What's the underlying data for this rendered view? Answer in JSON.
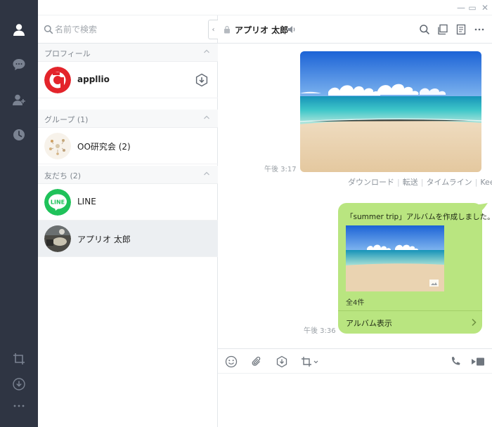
{
  "window": {
    "minimize_glyph": "—",
    "maximize_glyph": "▭",
    "close_glyph": "✕"
  },
  "rail": {
    "items": [
      "friends-icon",
      "chats-icon",
      "add-friend-icon",
      "timeline-icon"
    ],
    "bottom": [
      "screenshot-icon",
      "download-icon",
      "more-icon"
    ]
  },
  "sidebar": {
    "search_placeholder": "名前で検索",
    "collapse_glyph": "‹",
    "sections": {
      "profile": {
        "label": "プロフィール"
      },
      "groups": {
        "label": "グループ (1)"
      },
      "friends": {
        "label": "友だち (2)"
      }
    },
    "profile": {
      "name": "appllio"
    },
    "groups": [
      {
        "name": "OO研究会 (2)"
      }
    ],
    "friends": [
      {
        "name": "LINE"
      },
      {
        "name": "アプリオ 太郎"
      }
    ]
  },
  "chat": {
    "title": "アプリオ 太郎",
    "messages": {
      "photo_time": "午後 3:17",
      "actions": [
        "ダウンロード",
        "転送",
        "タイムライン",
        "Keep"
      ],
      "album_text": "「summer trip」アルバムを作成しました。",
      "album_count": "全4件",
      "album_open": "アルバム表示",
      "album_time": "午後 3:36"
    }
  },
  "colors": {
    "rail": "#2f3543",
    "bubble": "#b9e580",
    "selected_row": "#eceff2"
  }
}
